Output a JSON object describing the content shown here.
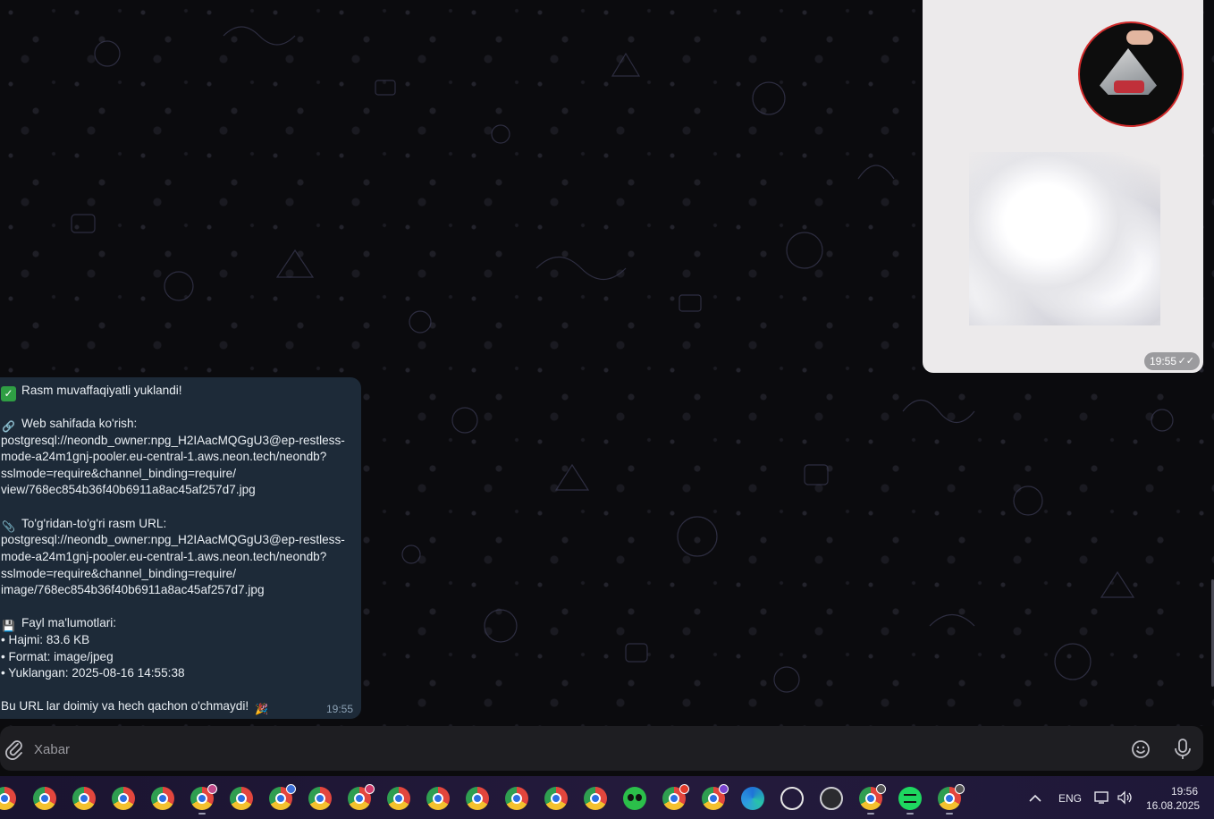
{
  "image_message": {
    "time": "19:55",
    "status": "read"
  },
  "text_message": {
    "lines": [
      "Rasm muvaffaqiyatli yuklandi!",
      "Web sahifada ko'rish:",
      "postgresql://neondb_owner:npg_H2IAacMQGgU3@ep-restless-",
      "mode-a24m1gnj-pooler.eu-central-1.aws.neon.tech/neondb?",
      "sslmode=require&channel_binding=require/",
      "view/768ec854b36f40b6911a8ac45af257d7.jpg",
      "To'g'ridan-to'g'ri rasm URL:",
      "postgresql://neondb_owner:npg_H2IAacMQGgU3@ep-restless-",
      "mode-a24m1gnj-pooler.eu-central-1.aws.neon.tech/neondb?",
      "sslmode=require&channel_binding=require/",
      "image/768ec854b36f40b6911a8ac45af257d7.jpg",
      "Fayl ma'lumotlari:",
      "• Hajmi: 83.6 KB",
      "• Format: image/jpeg",
      "• Yuklangan: 2025-08-16 14:55:38",
      "Bu URL lar doimiy va hech qachon o'chmaydi!"
    ],
    "time": "19:55"
  },
  "composer": {
    "placeholder": "Xabar"
  },
  "taskbar": {
    "language": "ENG",
    "time": "19:56",
    "date": "16.08.2025"
  },
  "icons": {
    "attach": "paperclip-icon",
    "emoji": "smiley-icon",
    "mic": "microphone-icon",
    "check_emoji": "check-mark-button",
    "link_emoji": "link-icon",
    "clip_emoji": "paperclip-icon",
    "disk_emoji": "floppy-disk-icon",
    "party_emoji": "party-popper-icon"
  },
  "colors": {
    "bubble": "#1d2a38",
    "check_emoji": "#2f9e44",
    "circle_border": "#d02a2a"
  }
}
